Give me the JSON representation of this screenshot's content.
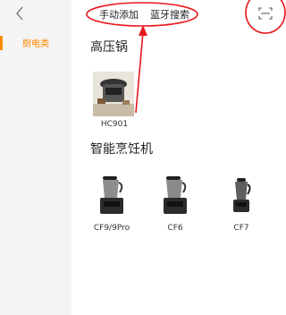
{
  "sidebar": {
    "categories": [
      {
        "label": "厨电类",
        "active": true
      }
    ]
  },
  "header": {
    "tabs": [
      {
        "label": "手动添加"
      },
      {
        "label": "蓝牙搜索"
      }
    ]
  },
  "sections": [
    {
      "title": "高压锅",
      "devices": [
        {
          "label": "HC901"
        }
      ]
    },
    {
      "title": "智能烹饪机",
      "devices": [
        {
          "label": "CF9/9Pro"
        },
        {
          "label": "CF6"
        },
        {
          "label": "CF7"
        }
      ]
    }
  ],
  "colors": {
    "accent": "#ff8a00",
    "annotation": "#e8181c",
    "sidebar_bg": "#f4f4f4"
  },
  "icons": {
    "back": "chevron-left-icon",
    "scan": "scan-icon"
  }
}
